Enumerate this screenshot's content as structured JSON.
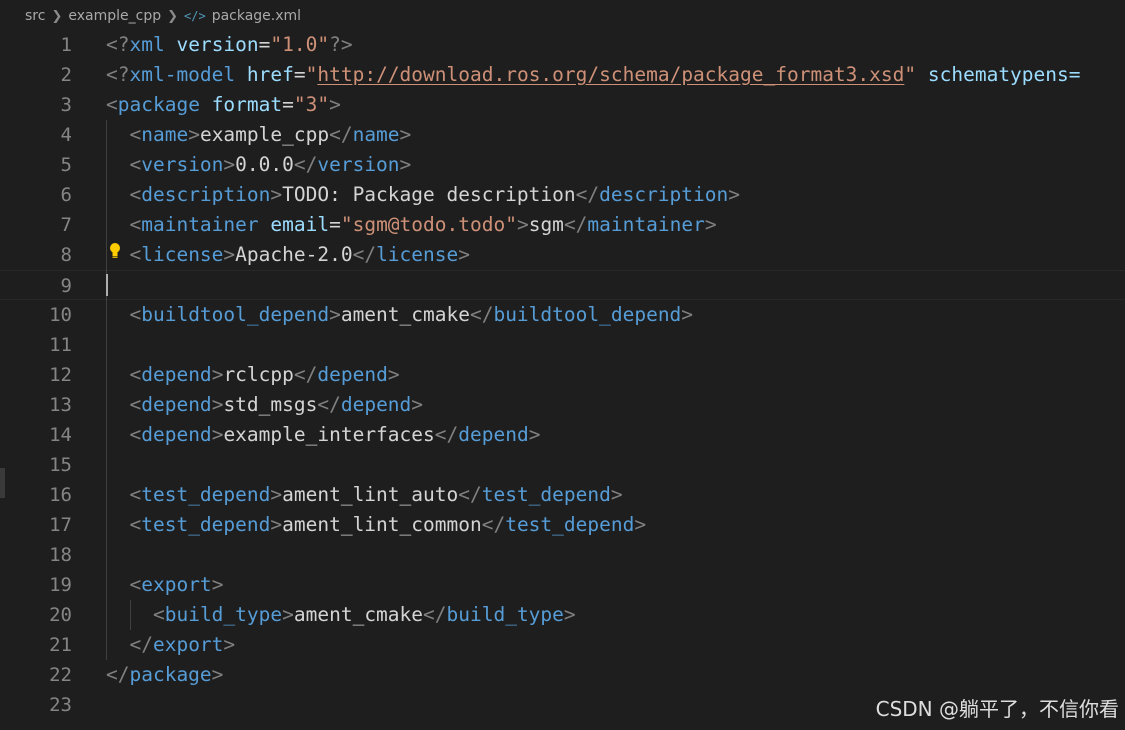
{
  "breadcrumb": {
    "items": [
      "src",
      "example_cpp",
      "package.xml"
    ],
    "file_icon": "</>"
  },
  "editor": {
    "active_line": 9,
    "lines": [
      {
        "n": "1",
        "segs": [
          [
            "p",
            "<?"
          ],
          [
            "t",
            "xml"
          ],
          [
            "x",
            " "
          ],
          [
            "a",
            "version"
          ],
          [
            "x",
            "="
          ],
          [
            "s",
            "\"1.0\""
          ],
          [
            "p",
            "?>"
          ]
        ]
      },
      {
        "n": "2",
        "segs": [
          [
            "p",
            "<?"
          ],
          [
            "t",
            "xml-model"
          ],
          [
            "x",
            " "
          ],
          [
            "a",
            "href"
          ],
          [
            "x",
            "="
          ],
          [
            "s",
            "\""
          ],
          [
            "u",
            "http://download.ros.org/schema/package_format3.xsd"
          ],
          [
            "s",
            "\""
          ],
          [
            "x",
            " "
          ],
          [
            "a",
            "schematypens="
          ]
        ]
      },
      {
        "n": "3",
        "segs": [
          [
            "p",
            "<"
          ],
          [
            "t",
            "package"
          ],
          [
            "x",
            " "
          ],
          [
            "a",
            "format"
          ],
          [
            "x",
            "="
          ],
          [
            "s",
            "\"3\""
          ],
          [
            "p",
            ">"
          ]
        ]
      },
      {
        "n": "4",
        "segs": [
          [
            "x",
            "  "
          ],
          [
            "p",
            "<"
          ],
          [
            "t",
            "name"
          ],
          [
            "p",
            ">"
          ],
          [
            "x",
            "example_cpp"
          ],
          [
            "p",
            "</"
          ],
          [
            "t",
            "name"
          ],
          [
            "p",
            ">"
          ]
        ]
      },
      {
        "n": "5",
        "segs": [
          [
            "x",
            "  "
          ],
          [
            "p",
            "<"
          ],
          [
            "t",
            "version"
          ],
          [
            "p",
            ">"
          ],
          [
            "x",
            "0.0.0"
          ],
          [
            "p",
            "</"
          ],
          [
            "t",
            "version"
          ],
          [
            "p",
            ">"
          ]
        ]
      },
      {
        "n": "6",
        "segs": [
          [
            "x",
            "  "
          ],
          [
            "p",
            "<"
          ],
          [
            "t",
            "description"
          ],
          [
            "p",
            ">"
          ],
          [
            "x",
            "TODO: Package description"
          ],
          [
            "p",
            "</"
          ],
          [
            "t",
            "description"
          ],
          [
            "p",
            ">"
          ]
        ]
      },
      {
        "n": "7",
        "segs": [
          [
            "x",
            "  "
          ],
          [
            "p",
            "<"
          ],
          [
            "t",
            "maintainer"
          ],
          [
            "x",
            " "
          ],
          [
            "a",
            "email"
          ],
          [
            "x",
            "="
          ],
          [
            "s",
            "\"sgm@todo.todo\""
          ],
          [
            "p",
            ">"
          ],
          [
            "x",
            "sgm"
          ],
          [
            "p",
            "</"
          ],
          [
            "t",
            "maintainer"
          ],
          [
            "p",
            ">"
          ]
        ]
      },
      {
        "n": "8",
        "segs": [
          [
            "x",
            "  "
          ],
          [
            "p",
            "<"
          ],
          [
            "t",
            "license"
          ],
          [
            "p",
            ">"
          ],
          [
            "x",
            "Apache-2.0"
          ],
          [
            "p",
            "</"
          ],
          [
            "t",
            "license"
          ],
          [
            "p",
            ">"
          ]
        ]
      },
      {
        "n": "9",
        "segs": []
      },
      {
        "n": "10",
        "segs": [
          [
            "x",
            "  "
          ],
          [
            "p",
            "<"
          ],
          [
            "t",
            "buildtool_depend"
          ],
          [
            "p",
            ">"
          ],
          [
            "x",
            "ament_cmake"
          ],
          [
            "p",
            "</"
          ],
          [
            "t",
            "buildtool_depend"
          ],
          [
            "p",
            ">"
          ]
        ]
      },
      {
        "n": "11",
        "segs": []
      },
      {
        "n": "12",
        "segs": [
          [
            "x",
            "  "
          ],
          [
            "p",
            "<"
          ],
          [
            "t",
            "depend"
          ],
          [
            "p",
            ">"
          ],
          [
            "x",
            "rclcpp"
          ],
          [
            "p",
            "</"
          ],
          [
            "t",
            "depend"
          ],
          [
            "p",
            ">"
          ]
        ]
      },
      {
        "n": "13",
        "segs": [
          [
            "x",
            "  "
          ],
          [
            "p",
            "<"
          ],
          [
            "t",
            "depend"
          ],
          [
            "p",
            ">"
          ],
          [
            "x",
            "std_msgs"
          ],
          [
            "p",
            "</"
          ],
          [
            "t",
            "depend"
          ],
          [
            "p",
            ">"
          ]
        ]
      },
      {
        "n": "14",
        "segs": [
          [
            "x",
            "  "
          ],
          [
            "p",
            "<"
          ],
          [
            "t",
            "depend"
          ],
          [
            "p",
            ">"
          ],
          [
            "x",
            "example_interfaces"
          ],
          [
            "p",
            "</"
          ],
          [
            "t",
            "depend"
          ],
          [
            "p",
            ">"
          ]
        ]
      },
      {
        "n": "15",
        "segs": []
      },
      {
        "n": "16",
        "segs": [
          [
            "x",
            "  "
          ],
          [
            "p",
            "<"
          ],
          [
            "t",
            "test_depend"
          ],
          [
            "p",
            ">"
          ],
          [
            "x",
            "ament_lint_auto"
          ],
          [
            "p",
            "</"
          ],
          [
            "t",
            "test_depend"
          ],
          [
            "p",
            ">"
          ]
        ]
      },
      {
        "n": "17",
        "segs": [
          [
            "x",
            "  "
          ],
          [
            "p",
            "<"
          ],
          [
            "t",
            "test_depend"
          ],
          [
            "p",
            ">"
          ],
          [
            "x",
            "ament_lint_common"
          ],
          [
            "p",
            "</"
          ],
          [
            "t",
            "test_depend"
          ],
          [
            "p",
            ">"
          ]
        ]
      },
      {
        "n": "18",
        "segs": []
      },
      {
        "n": "19",
        "segs": [
          [
            "x",
            "  "
          ],
          [
            "p",
            "<"
          ],
          [
            "t",
            "export"
          ],
          [
            "p",
            ">"
          ]
        ]
      },
      {
        "n": "20",
        "segs": [
          [
            "x",
            "    "
          ],
          [
            "p",
            "<"
          ],
          [
            "t",
            "build_type"
          ],
          [
            "p",
            ">"
          ],
          [
            "x",
            "ament_cmake"
          ],
          [
            "p",
            "</"
          ],
          [
            "t",
            "build_type"
          ],
          [
            "p",
            ">"
          ]
        ]
      },
      {
        "n": "21",
        "segs": [
          [
            "x",
            "  "
          ],
          [
            "p",
            "</"
          ],
          [
            "t",
            "export"
          ],
          [
            "p",
            ">"
          ]
        ]
      },
      {
        "n": "22",
        "segs": [
          [
            "p",
            "</"
          ],
          [
            "t",
            "package"
          ],
          [
            "p",
            ">"
          ]
        ]
      },
      {
        "n": "23",
        "segs": []
      }
    ]
  },
  "lightbulb": {
    "line": 8,
    "icon": "lightbulb-icon",
    "color": "#ffcc00"
  },
  "colors": {
    "background": "#1e1e1e",
    "tag": "#569cd6",
    "attribute": "#9cdcfe",
    "string": "#ce9178",
    "punctuation": "#808080",
    "text": "#d4d4d4",
    "line_number": "#858585"
  },
  "watermark": "CSDN @躺平了，不信你看"
}
